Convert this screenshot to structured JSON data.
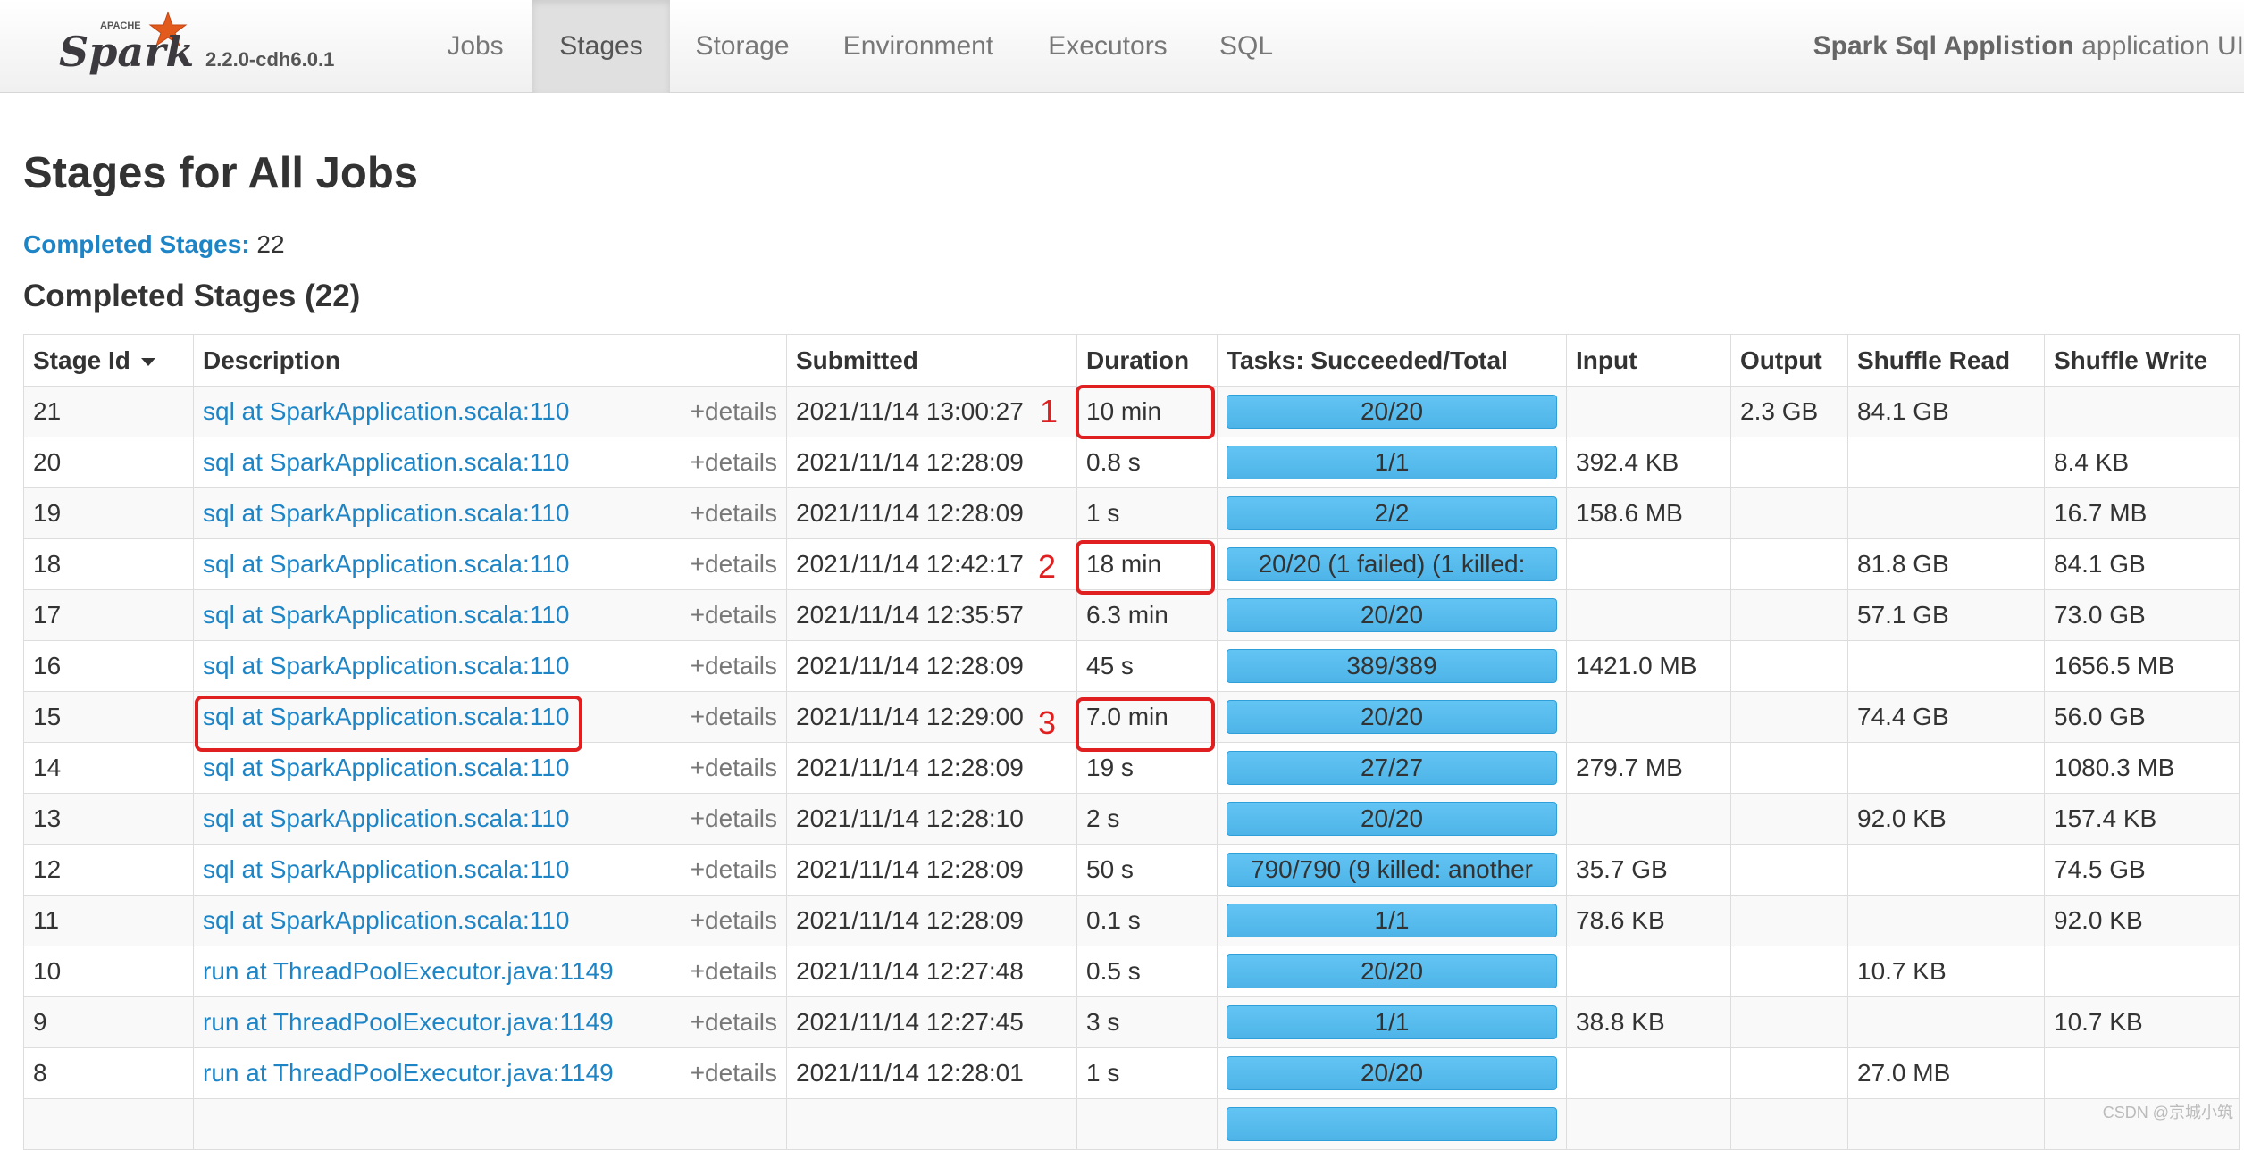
{
  "navbar": {
    "logo_text": "Spark",
    "logo_sup": "APACHE",
    "version": "2.2.0-cdh6.0.1",
    "tabs": [
      "Jobs",
      "Stages",
      "Storage",
      "Environment",
      "Executors",
      "SQL"
    ],
    "active_tab": "Stages",
    "app_name": "Spark Sql Applistion",
    "app_suffix": "application UI"
  },
  "page": {
    "title": "Stages for All Jobs",
    "completed_label": "Completed Stages:",
    "completed_count": "22",
    "section_title": "Completed Stages (22)"
  },
  "table": {
    "headers": [
      "Stage Id",
      "Description",
      "Submitted",
      "Duration",
      "Tasks: Succeeded/Total",
      "Input",
      "Output",
      "Shuffle Read",
      "Shuffle Write"
    ],
    "details_label": "+details",
    "rows": [
      {
        "id": "21",
        "desc": "sql at SparkApplication.scala:110",
        "submitted": "2021/11/14 13:00:27",
        "duration": "10 min",
        "tasks": "20/20",
        "progress": 1.0,
        "input": "",
        "output": "2.3 GB",
        "shuffle_read": "84.1 GB",
        "shuffle_write": ""
      },
      {
        "id": "20",
        "desc": "sql at SparkApplication.scala:110",
        "submitted": "2021/11/14 12:28:09",
        "duration": "0.8 s",
        "tasks": "1/1",
        "progress": 1.0,
        "input": "392.4 KB",
        "output": "",
        "shuffle_read": "",
        "shuffle_write": "8.4 KB"
      },
      {
        "id": "19",
        "desc": "sql at SparkApplication.scala:110",
        "submitted": "2021/11/14 12:28:09",
        "duration": "1 s",
        "tasks": "2/2",
        "progress": 1.0,
        "input": "158.6 MB",
        "output": "",
        "shuffle_read": "",
        "shuffle_write": "16.7 MB"
      },
      {
        "id": "18",
        "desc": "sql at SparkApplication.scala:110",
        "submitted": "2021/11/14 12:42:17",
        "duration": "18 min",
        "tasks": "20/20 (1 failed) (1 killed:",
        "progress": 1.0,
        "input": "",
        "output": "",
        "shuffle_read": "81.8 GB",
        "shuffle_write": "84.1 GB"
      },
      {
        "id": "17",
        "desc": "sql at SparkApplication.scala:110",
        "submitted": "2021/11/14 12:35:57",
        "duration": "6.3 min",
        "tasks": "20/20",
        "progress": 1.0,
        "input": "",
        "output": "",
        "shuffle_read": "57.1 GB",
        "shuffle_write": "73.0 GB"
      },
      {
        "id": "16",
        "desc": "sql at SparkApplication.scala:110",
        "submitted": "2021/11/14 12:28:09",
        "duration": "45 s",
        "tasks": "389/389",
        "progress": 1.0,
        "input": "1421.0 MB",
        "output": "",
        "shuffle_read": "",
        "shuffle_write": "1656.5 MB"
      },
      {
        "id": "15",
        "desc": "sql at SparkApplication.scala:110",
        "submitted": "2021/11/14 12:29:00",
        "duration": "7.0 min",
        "tasks": "20/20",
        "progress": 1.0,
        "input": "",
        "output": "",
        "shuffle_read": "74.4 GB",
        "shuffle_write": "56.0 GB"
      },
      {
        "id": "14",
        "desc": "sql at SparkApplication.scala:110",
        "submitted": "2021/11/14 12:28:09",
        "duration": "19 s",
        "tasks": "27/27",
        "progress": 1.0,
        "input": "279.7 MB",
        "output": "",
        "shuffle_read": "",
        "shuffle_write": "1080.3 MB"
      },
      {
        "id": "13",
        "desc": "sql at SparkApplication.scala:110",
        "submitted": "2021/11/14 12:28:10",
        "duration": "2 s",
        "tasks": "20/20",
        "progress": 1.0,
        "input": "",
        "output": "",
        "shuffle_read": "92.0 KB",
        "shuffle_write": "157.4 KB"
      },
      {
        "id": "12",
        "desc": "sql at SparkApplication.scala:110",
        "submitted": "2021/11/14 12:28:09",
        "duration": "50 s",
        "tasks": "790/790 (9 killed: another",
        "progress": 1.0,
        "input": "35.7 GB",
        "output": "",
        "shuffle_read": "",
        "shuffle_write": "74.5 GB"
      },
      {
        "id": "11",
        "desc": "sql at SparkApplication.scala:110",
        "submitted": "2021/11/14 12:28:09",
        "duration": "0.1 s",
        "tasks": "1/1",
        "progress": 1.0,
        "input": "78.6 KB",
        "output": "",
        "shuffle_read": "",
        "shuffle_write": "92.0 KB"
      },
      {
        "id": "10",
        "desc": "run at ThreadPoolExecutor.java:1149",
        "submitted": "2021/11/14 12:27:48",
        "duration": "0.5 s",
        "tasks": "20/20",
        "progress": 1.0,
        "input": "",
        "output": "",
        "shuffle_read": "10.7 KB",
        "shuffle_write": ""
      },
      {
        "id": "9",
        "desc": "run at ThreadPoolExecutor.java:1149",
        "submitted": "2021/11/14 12:27:45",
        "duration": "3 s",
        "tasks": "1/1",
        "progress": 1.0,
        "input": "38.8 KB",
        "output": "",
        "shuffle_read": "",
        "shuffle_write": "10.7 KB"
      },
      {
        "id": "8",
        "desc": "run at ThreadPoolExecutor.java:1149",
        "submitted": "2021/11/14 12:28:01",
        "duration": "1 s",
        "tasks": "20/20",
        "progress": 1.0,
        "input": "",
        "output": "",
        "shuffle_read": "27.0 MB",
        "shuffle_write": ""
      },
      {
        "id": "",
        "desc": "",
        "submitted": "",
        "duration": "",
        "tasks": "",
        "progress": 1.0,
        "input": "",
        "output": "",
        "shuffle_read": "",
        "shuffle_write": ""
      }
    ]
  },
  "annotations": [
    "1",
    "2",
    "3"
  ],
  "colors": {
    "link": "#1d84c6",
    "progress": "#58bcef",
    "highlight": "#e02020"
  },
  "watermark": "CSDN @京城小筑"
}
